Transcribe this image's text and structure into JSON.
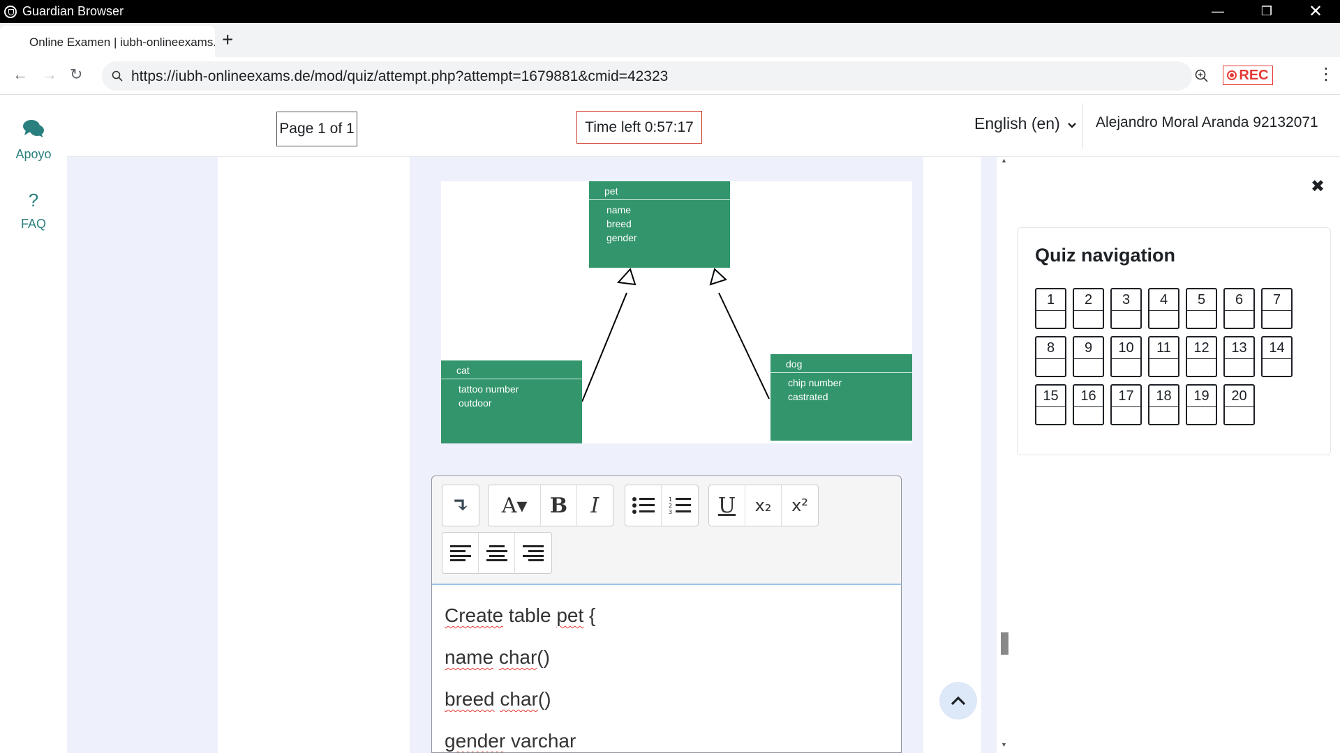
{
  "window": {
    "title": "Guardian Browser"
  },
  "tab": {
    "title": "Online Examen | iubh-onlineexams.de",
    "new_tab_icon": "+"
  },
  "address": {
    "url": "https://iubh-onlineexams.de/mod/quiz/attempt.php?attempt=1679881&cmid=42323",
    "rec_label": "REC"
  },
  "rail": {
    "support_label": "Apoyo",
    "faq_label": "FAQ",
    "faq_icon": "?"
  },
  "header": {
    "page_indicator": "Page 1 of 1",
    "time_left": "Time left 0:57:17",
    "language": "English (en)",
    "user": "Alejandro Moral Aranda 92132071"
  },
  "diagram": {
    "pet": {
      "title": "pet",
      "attrs": [
        "name",
        "breed",
        "gender"
      ]
    },
    "cat": {
      "title": "cat",
      "attrs": [
        "tattoo number",
        "outdoor"
      ]
    },
    "dog": {
      "title": "dog",
      "attrs": [
        "chip number",
        "castrated"
      ]
    },
    "box_color": "#33956c"
  },
  "editor": {
    "lines": [
      [
        "Create",
        " table ",
        "pet",
        " {"
      ],
      [
        "name",
        " ",
        "char",
        "()"
      ],
      [
        "breed",
        " ",
        "char",
        "()"
      ],
      [
        "gender",
        " varchar",
        "",
        ""
      ]
    ],
    "toolbar": {
      "expand": "↴",
      "font": "A▾",
      "bold": "B",
      "italic": "I",
      "underline": "U",
      "subscript": "x₂",
      "superscript": "x²"
    }
  },
  "quiz_nav": {
    "title": "Quiz navigation",
    "questions": [
      "1",
      "2",
      "3",
      "4",
      "5",
      "6",
      "7",
      "8",
      "9",
      "10",
      "11",
      "12",
      "13",
      "14",
      "15",
      "16",
      "17",
      "18",
      "19",
      "20"
    ]
  }
}
